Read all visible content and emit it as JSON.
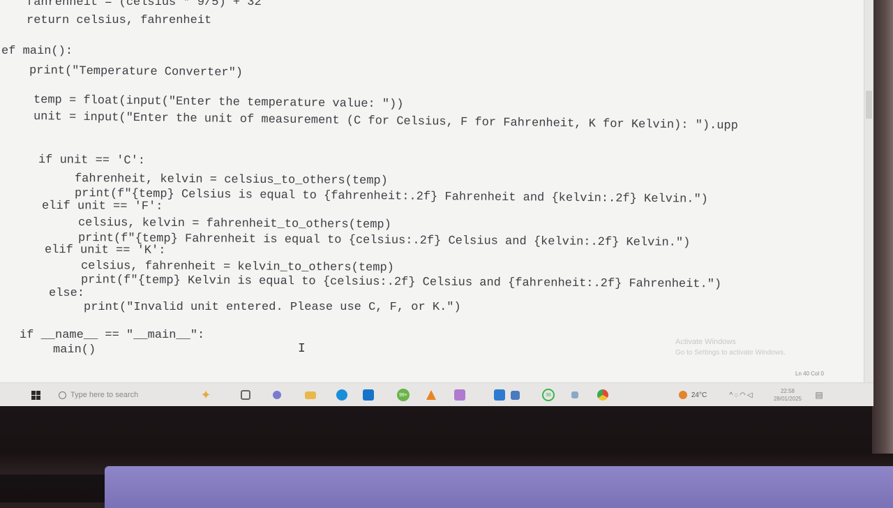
{
  "code": {
    "lines": [
      "fahrenheit = (celsius * 9/5) + 32",
      "return celsius, fahrenheit",
      "ef main():",
      "print(\"Temperature Converter\")",
      "temp = float(input(\"Enter the temperature value: \"))",
      "unit = input(\"Enter the unit of measurement (C for Celsius, F for Fahrenheit, K for Kelvin): \").upp",
      "if unit == 'C':",
      "fahrenheit, kelvin = celsius_to_others(temp)",
      "print(f\"{temp} Celsius is equal to {fahrenheit:.2f} Fahrenheit and {kelvin:.2f} Kelvin.\")",
      "elif unit == 'F':",
      "celsius, kelvin = fahrenheit_to_others(temp)",
      "print(f\"{temp} Fahrenheit is equal to {celsius:.2f} Celsius and {kelvin:.2f} Kelvin.\")",
      "elif unit == 'K':",
      "celsius, fahrenheit = kelvin_to_others(temp)",
      "print(f\"{temp} Kelvin is equal to {celsius:.2f} Celsius and {fahrenheit:.2f} Fahrenheit.\")",
      "else:",
      "print(\"Invalid unit entered. Please use C, F, or K.\")",
      "if __name__ == \"__main__\":",
      "main()"
    ]
  },
  "watermark": {
    "line1": "Activate Windows",
    "line2": "Go to Settings to activate Windows."
  },
  "status": {
    "position": "Ln 40  Col 0"
  },
  "taskbar": {
    "search_placeholder": "Type here to search",
    "weather": "24°C",
    "time": "22:58",
    "date": "28/01/2025",
    "badge_1": "99+",
    "badge_2": "36",
    "icons": [
      "start-icon",
      "search-icon",
      "copilot-icon",
      "task-view-icon",
      "app-icon",
      "file-explorer-icon",
      "edge-icon",
      "outlook-icon",
      "app-badge-icon",
      "vlc-icon",
      "store-icon",
      "vscode-icon",
      "app-icon",
      "whatsapp-icon",
      "app-icon",
      "chrome-icon"
    ],
    "colors": {
      "accent": "#e6a93a",
      "taskbar": "#e7e6e4"
    }
  }
}
